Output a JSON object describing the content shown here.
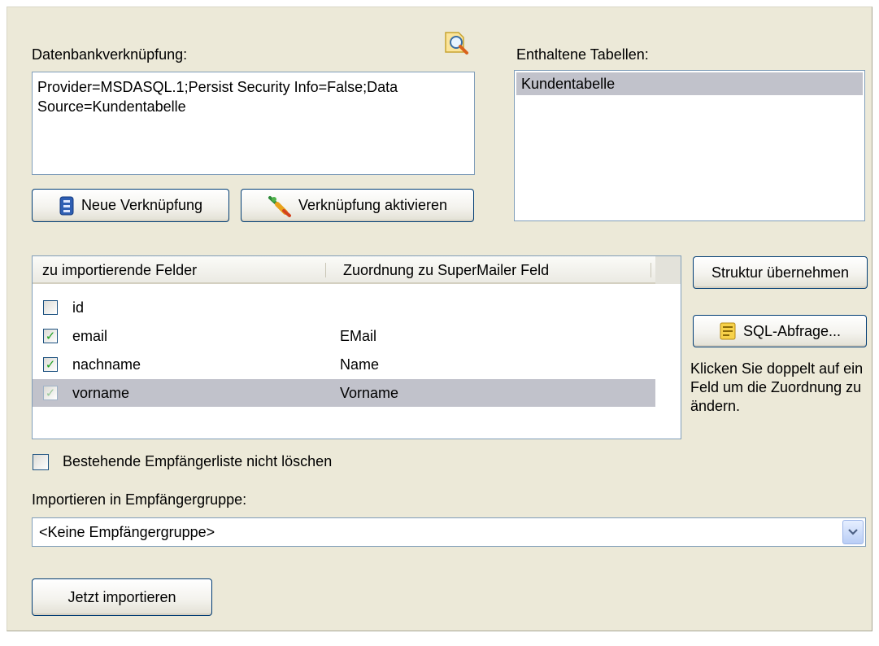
{
  "connection": {
    "label": "Datenbankverknüpfung:",
    "value": "Provider=MSDASQL.1;Persist Security Info=False;Data Source=Kundentabelle",
    "browse_icon": "magnifier-icon"
  },
  "tables": {
    "label": "Enthaltene Tabellen:",
    "items": [
      "Kundentabelle"
    ],
    "selected": "Kundentabelle"
  },
  "buttons": {
    "new_link": "Neue Verknüpfung",
    "activate_link": "Verknüpfung aktivieren",
    "adopt_structure": "Struktur übernehmen",
    "sql_query": "SQL-Abfrage...",
    "import_now": "Jetzt importieren"
  },
  "fields": {
    "columns": [
      "zu importierende Felder",
      "Zuordnung zu SuperMailer Feld"
    ],
    "rows": [
      {
        "field": "id",
        "mapping": "",
        "checked": false
      },
      {
        "field": "email",
        "mapping": "EMail",
        "checked": true
      },
      {
        "field": "nachname",
        "mapping": "Name",
        "checked": true
      },
      {
        "field": "vorname",
        "mapping": "Vorname",
        "checked": true
      }
    ],
    "hint": "Klicken Sie doppelt auf ein Feld um die Zuordnung zu ändern."
  },
  "keep_list": {
    "label": "Bestehende Empfängerliste nicht löschen",
    "checked": false
  },
  "group": {
    "label": "Importieren in Empfängergruppe:",
    "selected": "<Keine Empfängergruppe>"
  },
  "colors": {
    "panel": "#ece9d8",
    "border": "#7f9db9",
    "selection": "#c1c2cb",
    "check": "#21a121"
  }
}
